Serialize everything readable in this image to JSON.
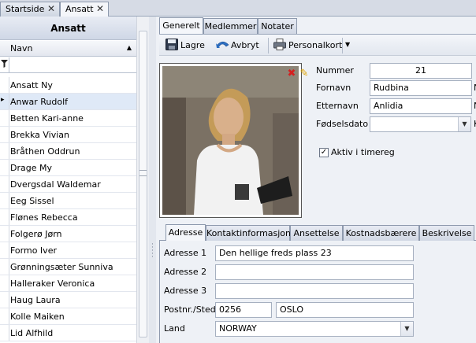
{
  "doc_tabs": [
    {
      "label": "Startside",
      "close": "✕"
    },
    {
      "label": "Ansatt",
      "close": "✕"
    }
  ],
  "left_panel": {
    "title": "Ansatt",
    "column_header": "Navn",
    "rows": [
      "Ansatt Ny",
      "Anwar Rudolf",
      "Betten Kari-anne",
      "Brekka Vivian",
      "Bråthen Oddrun",
      "Drage My",
      "Dvergsdal Waldemar",
      "Eeg Sissel",
      "Flønes Rebecca",
      "Folgerø Jørn",
      "Formo Iver",
      "Grønningsæter Sunniva",
      "Halleraker Veronica",
      "Haug Laura",
      "Kolle Maiken",
      "Lid Alfhild"
    ],
    "selected_index": 1
  },
  "panel_tabs": [
    "Generelt",
    "Medlemmer",
    "Notater"
  ],
  "toolbar": {
    "save_label": "Lagre",
    "cancel_label": "Avbryt",
    "personalkort_label": "Personalkort"
  },
  "form": {
    "nummer_label": "Nummer",
    "nummer_value": "21",
    "fornavn_label": "Fornavn",
    "fornavn_value": "Rudbina",
    "etternavn_label": "Etternavn",
    "etternavn_value": "Anlidia",
    "fodselsdato_label": "Fødselsdato",
    "fodselsdato_value": "",
    "aktiv_label": "Aktiv i timereg",
    "aktiv_checked": true,
    "cut_letter_1": "N",
    "cut_letter_2": "N",
    "cut_letter_3": "K"
  },
  "sub_tabs": [
    "Adresse",
    "Kontaktinformasjon",
    "Ansettelse",
    "Kostnadsbærere",
    "Beskrivelse"
  ],
  "address": {
    "adresse1_label": "Adresse 1",
    "adresse1_value": "Den hellige freds plass 23",
    "adresse2_label": "Adresse 2",
    "adresse2_value": "",
    "adresse3_label": "Adresse 3",
    "adresse3_value": "",
    "postnr_label": "Postnr./Sted",
    "postnr_value": "0256",
    "sted_value": "OSLO",
    "land_label": "Land",
    "land_value": "NORWAY"
  },
  "colors": {
    "accent": "#9aa6ba",
    "selected_row": "#dfe9f7",
    "delete_icon": "#d42020",
    "edit_icon": "#e0a400"
  }
}
